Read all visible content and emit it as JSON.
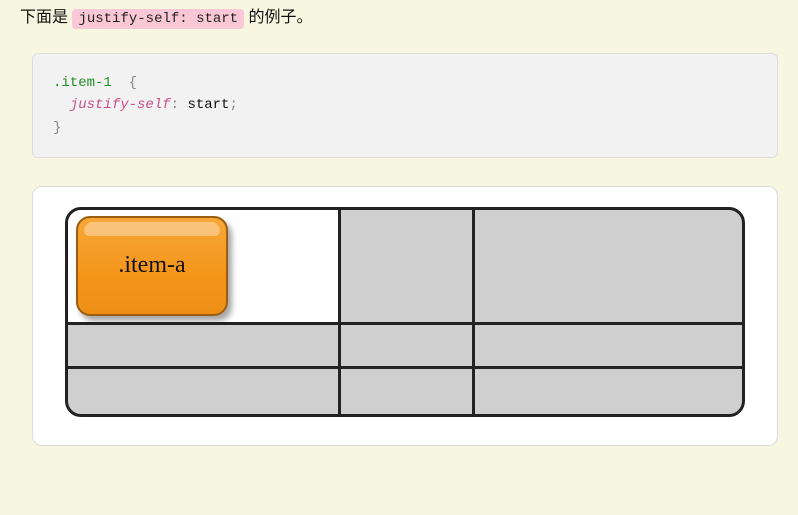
{
  "intro": {
    "prefix": "下面是 ",
    "code": "justify-self: start",
    "suffix": " 的例子。"
  },
  "code": {
    "selector": ".item-1",
    "brace_open": "  {",
    "indent": "  ",
    "property": "justify-self",
    "colon": ": ",
    "value": "start",
    "semicolon": ";",
    "brace_close": "}"
  },
  "figure": {
    "item_label": ".item-a"
  }
}
